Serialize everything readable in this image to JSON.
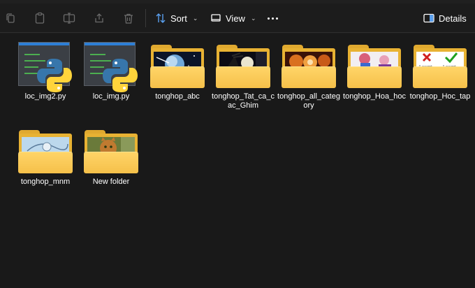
{
  "toolbar": {
    "sort_label": "Sort",
    "view_label": "View",
    "details_label": "Details",
    "icons": [
      "copy-icon",
      "paste-icon",
      "rename-icon",
      "share-icon",
      "delete-icon",
      "sort-icon",
      "view-icon",
      "more-icon",
      "details-pane-icon"
    ]
  },
  "files": [
    {
      "name": "loc_img2.py",
      "type": "python"
    },
    {
      "name": "loc_img.py",
      "type": "python"
    },
    {
      "name": "tonghop_abc",
      "type": "folder",
      "thumb": "space-earth"
    },
    {
      "name": "tonghop_Tat_ca_cac_Ghim",
      "type": "folder",
      "thumb": "night-sky"
    },
    {
      "name": "tonghop_all_category",
      "type": "folder",
      "thumb": "orange-cat"
    },
    {
      "name": "tonghop_Hoa_hoc",
      "type": "folder",
      "thumb": "cartoon-art"
    },
    {
      "name": "tonghop_Hoc_tap",
      "type": "folder",
      "thumb": "i-accept-checkboxes",
      "thumb_text": [
        "I accept",
        "I accept"
      ]
    },
    {
      "name": "tonghop_mnm",
      "type": "folder",
      "thumb": "blue-sketch"
    },
    {
      "name": "New folder",
      "type": "folder",
      "thumb": "cat-photo"
    }
  ],
  "colors": {
    "background": "#191919",
    "toolbar": "#1c1c1c",
    "folder": "#f5c04a",
    "python_blue": "#3776ab",
    "python_yellow": "#ffd43b"
  }
}
